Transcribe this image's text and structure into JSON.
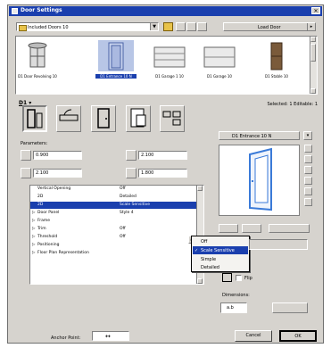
{
  "window": {
    "title": "Door Settings",
    "close": "✕"
  },
  "library": {
    "combo_value": "Included Doors 10",
    "load_button": "Load Door",
    "items": [
      {
        "label": "D1 Door Revolving 10",
        "icon": "revolving-door-icon"
      },
      {
        "label": "D1 Entrance 10 N",
        "icon": "entrance-door-icon",
        "selected": true
      },
      {
        "label": "D1 Garage 1 10",
        "icon": "garage-door-icon"
      },
      {
        "label": "D1 Garage 10",
        "icon": "garage-door-icon"
      },
      {
        "label": "D1 Stable 10",
        "icon": "stable-door-icon"
      }
    ]
  },
  "info": {
    "section_label": "D1 ▾",
    "selected_text": "Selected: 1 Editable: 1"
  },
  "preview": {
    "combo_value": "D1 Entrance 10 N"
  },
  "params": {
    "label": "Parameters:",
    "width_value": "0.900",
    "height_value": "2.100",
    "left_value": "2.100",
    "right_value": "1.800"
  },
  "table": {
    "rows": [
      {
        "name": "Vertical Opening",
        "value": "Off",
        "type": "plain"
      },
      {
        "name": "2D",
        "value": "Detailed",
        "type": "plain"
      },
      {
        "name": "2D",
        "value": "Scale Sensitive",
        "type": "selected"
      },
      {
        "name": "Door Panel",
        "value": "Style 4",
        "type": "expand"
      },
      {
        "name": "Frame",
        "value": "",
        "type": "expand"
      },
      {
        "name": "Trim",
        "value": "Off",
        "type": "expand"
      },
      {
        "name": "Threshold",
        "value": "Off",
        "type": "expand"
      },
      {
        "name": "Positioning",
        "value": "",
        "type": "expand"
      },
      {
        "name": "Floor Plan Representation",
        "value": "",
        "type": "expand"
      }
    ]
  },
  "dropdown": {
    "options": [
      {
        "label": "Off",
        "checked": false,
        "highlighted": false
      },
      {
        "label": "Scale Sensitive",
        "checked": true,
        "highlighted": true
      },
      {
        "label": "Simple",
        "checked": false,
        "highlighted": false
      },
      {
        "label": "Detailed",
        "checked": false,
        "highlighted": false
      }
    ]
  },
  "right_panel": {
    "flip_label": "Flip",
    "dimensions_label": "Dimensions:",
    "dimension_symbol": "a.b"
  },
  "footer": {
    "anchor_label": "Anchor Point:",
    "cancel": "Cancel",
    "ok": "OK"
  },
  "colors": {
    "selection": "#1a3fae",
    "title_bar": "#1a3fae",
    "dialog_bg": "#d6d3ce",
    "door_frame": "#3a7ad8"
  }
}
